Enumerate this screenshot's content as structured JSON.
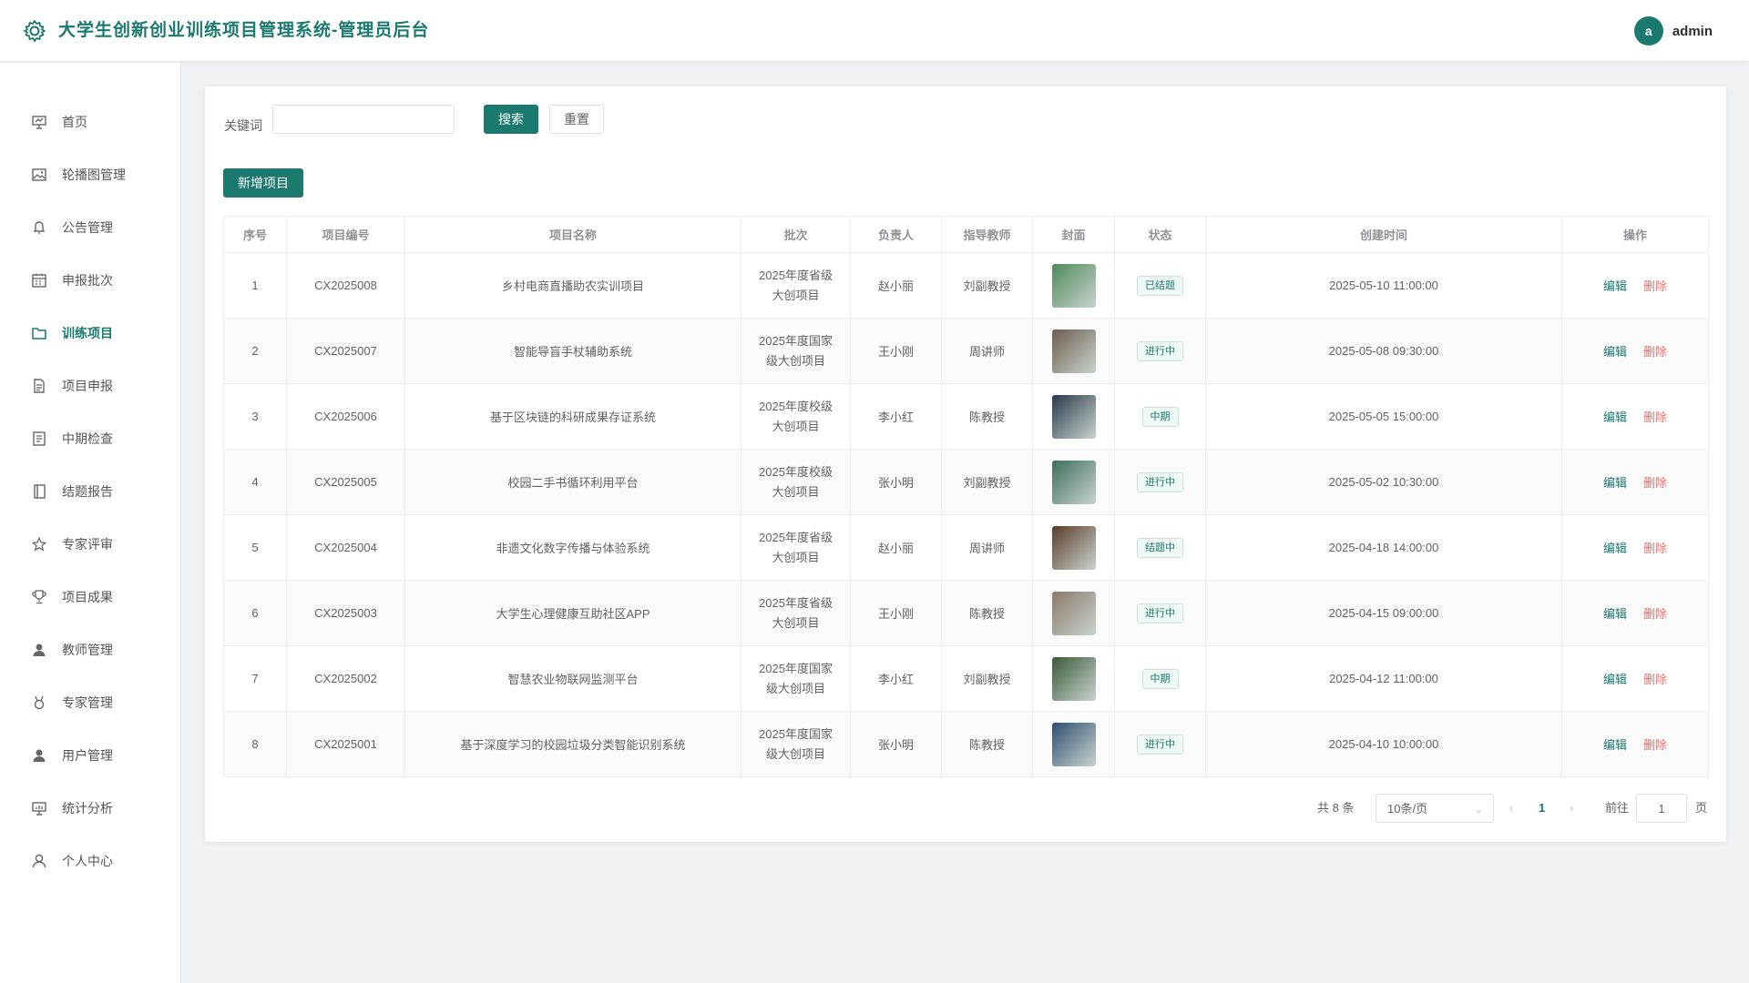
{
  "app": {
    "title": "大学生创新创业训练项目管理系统-管理员后台"
  },
  "user": {
    "avatar_letter": "a",
    "name": "admin"
  },
  "sidebar": {
    "items": [
      {
        "label": "首页",
        "icon": "presentation-icon"
      },
      {
        "label": "轮播图管理",
        "icon": "image-icon"
      },
      {
        "label": "公告管理",
        "icon": "bell-icon"
      },
      {
        "label": "申报批次",
        "icon": "calendar-icon"
      },
      {
        "label": "训练项目",
        "icon": "folder-icon",
        "active": true
      },
      {
        "label": "项目申报",
        "icon": "document-icon"
      },
      {
        "label": "中期检查",
        "icon": "notes-icon"
      },
      {
        "label": "结题报告",
        "icon": "book-icon"
      },
      {
        "label": "专家评审",
        "icon": "star-icon"
      },
      {
        "label": "项目成果",
        "icon": "trophy-icon"
      },
      {
        "label": "教师管理",
        "icon": "user-filled-icon"
      },
      {
        "label": "专家管理",
        "icon": "medal-icon"
      },
      {
        "label": "用户管理",
        "icon": "user-icon"
      },
      {
        "label": "统计分析",
        "icon": "chart-board-icon"
      },
      {
        "label": "个人中心",
        "icon": "person-outline-icon"
      }
    ]
  },
  "search": {
    "label": "关键词",
    "value": "",
    "search_button": "搜索",
    "reset_button": "重置"
  },
  "actions": {
    "add_button": "新增项目"
  },
  "table": {
    "columns": [
      "序号",
      "项目编号",
      "项目名称",
      "批次",
      "负责人",
      "指导教师",
      "封面",
      "状态",
      "创建时间",
      "操作"
    ],
    "edit_label": "编辑",
    "delete_label": "删除",
    "rows": [
      {
        "no": "1",
        "code": "CX2025008",
        "name": "乡村电商直播助农实训项目",
        "batch_line1": "2025年度省级",
        "batch_line2": "大创项目",
        "leader": "赵小丽",
        "teacher": "刘副教授",
        "status": "已结题",
        "created": "2025-05-10 11:00:00",
        "cover_color": "#4f8a5a"
      },
      {
        "no": "2",
        "code": "CX2025007",
        "name": "智能导盲手杖辅助系统",
        "batch_line1": "2025年度国家",
        "batch_line2": "级大创项目",
        "leader": "王小刚",
        "teacher": "周讲师",
        "status": "进行中",
        "created": "2025-05-08 09:30:00",
        "cover_color": "#6b5d4f"
      },
      {
        "no": "3",
        "code": "CX2025006",
        "name": "基于区块链的科研成果存证系统",
        "batch_line1": "2025年度校级",
        "batch_line2": "大创项目",
        "leader": "李小红",
        "teacher": "陈教授",
        "status": "中期",
        "created": "2025-05-05 15:00:00",
        "cover_color": "#2a3a4a"
      },
      {
        "no": "4",
        "code": "CX2025005",
        "name": "校园二手书循环利用平台",
        "batch_line1": "2025年度校级",
        "batch_line2": "大创项目",
        "leader": "张小明",
        "teacher": "刘副教授",
        "status": "进行中",
        "created": "2025-05-02 10:30:00",
        "cover_color": "#3f6f5a"
      },
      {
        "no": "5",
        "code": "CX2025004",
        "name": "非遗文化数字传播与体验系统",
        "batch_line1": "2025年度省级",
        "batch_line2": "大创项目",
        "leader": "赵小丽",
        "teacher": "周讲师",
        "status": "结题中",
        "created": "2025-04-18 14:00:00",
        "cover_color": "#5a3e2b"
      },
      {
        "no": "6",
        "code": "CX2025003",
        "name": "大学生心理健康互助社区APP",
        "batch_line1": "2025年度省级",
        "batch_line2": "大创项目",
        "leader": "王小刚",
        "teacher": "陈教授",
        "status": "进行中",
        "created": "2025-04-15 09:00:00",
        "cover_color": "#8a7a6a"
      },
      {
        "no": "7",
        "code": "CX2025002",
        "name": "智慧农业物联网监测平台",
        "batch_line1": "2025年度国家",
        "batch_line2": "级大创项目",
        "leader": "李小红",
        "teacher": "刘副教授",
        "status": "中期",
        "created": "2025-04-12 11:00:00",
        "cover_color": "#3a5a3a"
      },
      {
        "no": "8",
        "code": "CX2025001",
        "name": "基于深度学习的校园垃圾分类智能识别系统",
        "batch_line1": "2025年度国家",
        "batch_line2": "级大创项目",
        "leader": "张小明",
        "teacher": "陈教授",
        "status": "进行中",
        "created": "2025-04-10 10:00:00",
        "cover_color": "#2f4f6f"
      }
    ]
  },
  "pagination": {
    "total_text": "共 8 条",
    "page_size": "10条/页",
    "current_page": "1",
    "goto_label": "前往",
    "goto_value": "1",
    "page_suffix": "页"
  },
  "colors": {
    "accent": "#1a7a6e",
    "danger": "#f56c6c",
    "background": "#f0f2f5"
  }
}
